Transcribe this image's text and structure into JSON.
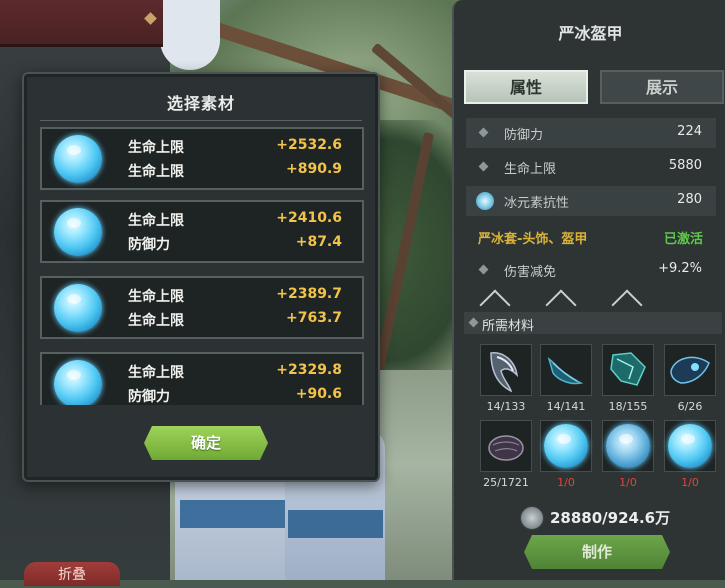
{
  "modal": {
    "title": "选择素材",
    "confirm_label": "确定",
    "materials": [
      {
        "stats": [
          {
            "name": "生命上限",
            "value": "+2532.6"
          },
          {
            "name": "生命上限",
            "value": "+890.9"
          }
        ]
      },
      {
        "stats": [
          {
            "name": "生命上限",
            "value": "+2410.6"
          },
          {
            "name": "防御力",
            "value": "+87.4"
          }
        ]
      },
      {
        "stats": [
          {
            "name": "生命上限",
            "value": "+2389.7"
          },
          {
            "name": "生命上限",
            "value": "+763.7"
          }
        ]
      },
      {
        "stats": [
          {
            "name": "生命上限",
            "value": "+2329.8"
          },
          {
            "name": "防御力",
            "value": "+90.6"
          }
        ]
      }
    ]
  },
  "panel": {
    "title": "严冰盔甲",
    "tabs": [
      {
        "label": "属性"
      },
      {
        "label": "展示"
      }
    ],
    "attributes": [
      {
        "name": "防御力",
        "value": "224",
        "icon": "diamond-bullet-icon"
      },
      {
        "name": "生命上限",
        "value": "5880",
        "icon": "diamond-bullet-icon"
      },
      {
        "name": "冰元素抗性",
        "value": "280",
        "icon": "ice-element-icon"
      }
    ],
    "set_bonus": {
      "name": "严冰套-头饰、盔甲",
      "status": "已激活"
    },
    "damage_reduction": {
      "name": "伤害减免",
      "value": "+9.2%"
    },
    "required_label": "所需材料",
    "required": [
      {
        "count": "14/133",
        "icon": "dark-claw-icon",
        "sufficient": true
      },
      {
        "count": "14/141",
        "icon": "dark-fang-icon",
        "sufficient": true
      },
      {
        "count": "18/155",
        "icon": "teal-crystal-icon",
        "sufficient": true
      },
      {
        "count": "6/26",
        "icon": "ice-beast-icon",
        "sufficient": true
      },
      {
        "count": "25/1721",
        "icon": "dark-ore-icon",
        "sufficient": true
      },
      {
        "count": "1/0",
        "icon": "ice-essence-icon",
        "sufficient": false
      },
      {
        "count": "1/0",
        "icon": "ice-essence-icon",
        "sufficient": false
      },
      {
        "count": "1/0",
        "icon": "ice-essence-icon",
        "sufficient": false
      }
    ],
    "cost": "28880/924.6万",
    "craft_label": "制作"
  },
  "hud": {
    "fold_label": "折叠"
  },
  "colors": {
    "stat_value": "#f2c34a",
    "confirm_button": "#8cc44a",
    "set_bonus_name": "#d9b23a",
    "set_bonus_status": "#5ec84a",
    "insufficient_count": "#e0443a"
  }
}
